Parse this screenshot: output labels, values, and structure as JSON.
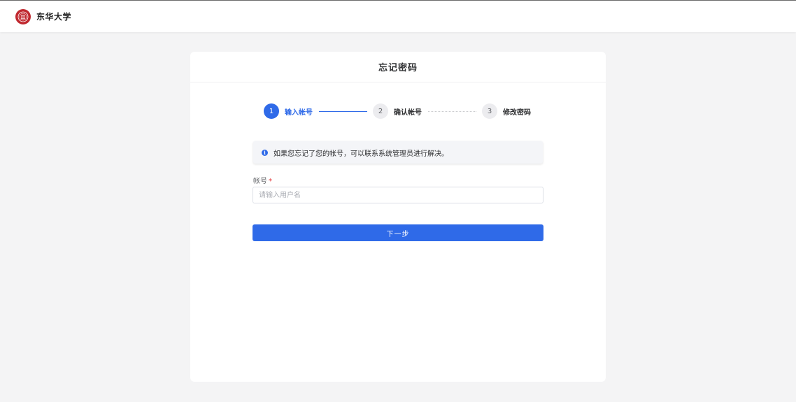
{
  "header": {
    "brand_name": "东华大学",
    "logo_icon": "university-seal-icon",
    "brand_color": "#c0282f"
  },
  "card": {
    "title": "忘记密码"
  },
  "steps": [
    {
      "number": "1",
      "label": "输入帐号",
      "state": "active"
    },
    {
      "number": "2",
      "label": "确认帐号",
      "state": "idle"
    },
    {
      "number": "3",
      "label": "修改密码",
      "state": "idle"
    }
  ],
  "info": {
    "icon": "info-icon",
    "text": "如果您忘记了您的帐号，可以联系系统管理员进行解决。"
  },
  "form": {
    "account_label": "帐号",
    "required_mark": "*",
    "account_value": "",
    "account_placeholder": "请输入用户名",
    "next_button_label": "下一步"
  },
  "colors": {
    "accent": "#2f6ae8",
    "page_background": "#f4f4f5",
    "required": "#e4393c"
  }
}
